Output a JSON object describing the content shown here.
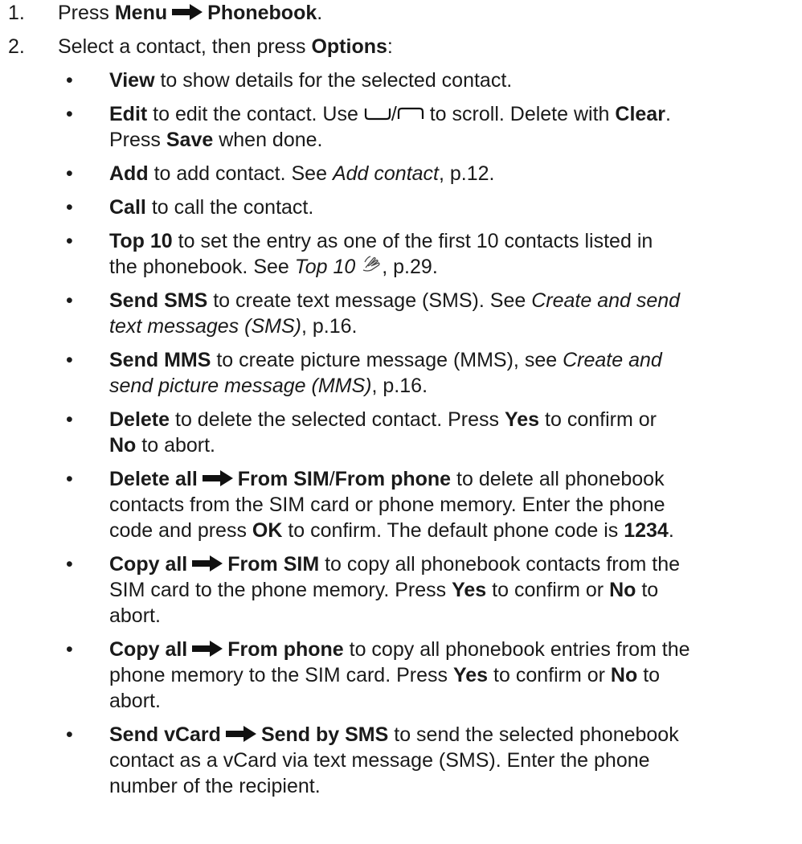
{
  "steps": [
    {
      "num": "1.",
      "prefix": "Press",
      "b1": "Menu",
      "b2": "Phonebook",
      "suffix": "."
    },
    {
      "num": "2.",
      "prefix": "Select a contact, then press",
      "b1": "Options",
      "suffix": ":"
    }
  ],
  "bullets": {
    "bullet_char": "•",
    "view": {
      "b": "View",
      "t": "to show details for the selected contact."
    },
    "edit": {
      "b": "Edit",
      "t1": "to edit the contact. Use",
      "slash": "/",
      "t2": "to scroll. Delete with",
      "b2": "Clear",
      "t3": ".",
      "t4": "Press",
      "b3": "Save",
      "t5": "when done."
    },
    "add": {
      "b": "Add",
      "t": "to add contact. See",
      "i": "Add contact",
      "t2": ", p.12."
    },
    "call": {
      "b": "Call",
      "t": "to call the contact."
    },
    "top10": {
      "b": "Top 10",
      "t1": "to set the entry as one of the first 10 contacts listed in",
      "t2": "the phonebook. See",
      "i": "Top 10",
      "t3": ", p.29."
    },
    "sms": {
      "b": "Send SMS",
      "t": "to create text message (SMS). See",
      "i1": "Create and send",
      "i2": "text messages (SMS)",
      "t2": ", p.16."
    },
    "mms": {
      "b": "Send MMS",
      "t": "to create picture message (MMS), see",
      "i1": "Create and",
      "i2": "send picture message (MMS)",
      "t2": ", p.16."
    },
    "delete": {
      "b": "Delete",
      "t1": "to delete the selected contact. Press",
      "b2": "Yes",
      "t2": "to confirm or",
      "b3": "No",
      "t3": "to abort."
    },
    "delete_all": {
      "b1": "Delete all",
      "b2": "From SIM",
      "slash": "/",
      "b3": "From phone",
      "t1": "to delete all phonebook",
      "t2": "contacts from the SIM card or phone memory. Enter the phone",
      "t3": "code and press",
      "b4": "OK",
      "t4": "to confirm. The default phone code is",
      "b5": "1234",
      "t5": "."
    },
    "copy_sim": {
      "b1": "Copy all",
      "b2": "From SIM",
      "t1": "to copy all phonebook contacts from the",
      "t2": "SIM card to the phone memory. Press",
      "b3": "Yes",
      "t3": "to confirm or",
      "b4": "No",
      "t4": "to",
      "t5": "abort."
    },
    "copy_phone": {
      "b1": "Copy all",
      "b2": "From phone",
      "t1": "to copy all phonebook entries from the",
      "t2": "phone memory to the SIM card. Press",
      "b3": "Yes",
      "t3": "to confirm or",
      "b4": "No",
      "t4": "to",
      "t5": "abort."
    },
    "vcard": {
      "b1": "Send vCard",
      "b2": "Send by SMS",
      "t1": "to send the selected phonebook",
      "t2": "contact as a vCard via text message (SMS). Enter the phone",
      "t3": "number of the recipient."
    }
  },
  "icons": {
    "arrow": "right-arrow-icon",
    "down_key": "scroll-down-key-icon",
    "up_key": "scroll-up-key-icon",
    "hand": "hand-gesture-icon"
  }
}
